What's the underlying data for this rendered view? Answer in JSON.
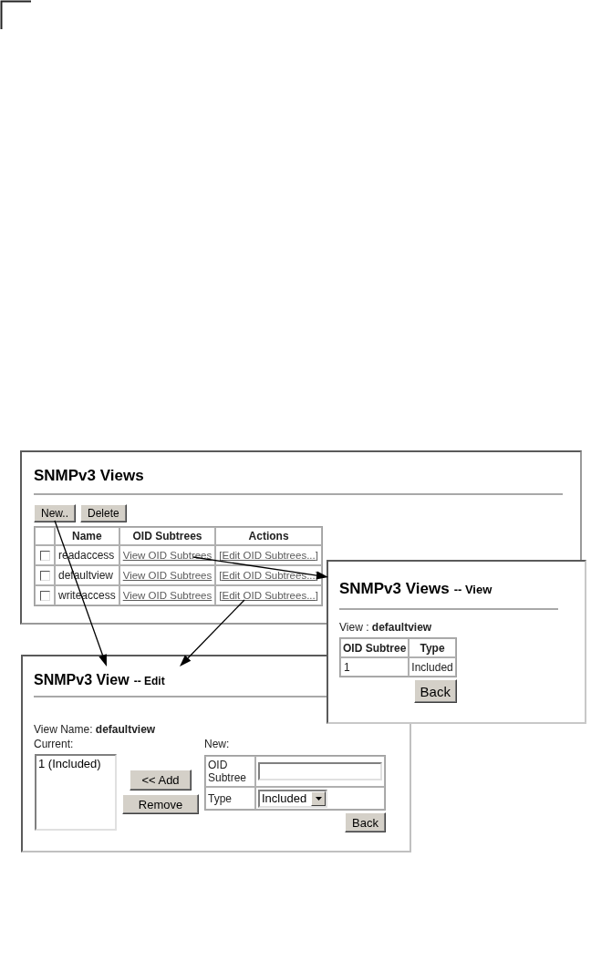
{
  "views_window": {
    "title": "SNMPv3 Views",
    "buttons": [
      {
        "label": "New.."
      },
      {
        "label": "Delete"
      }
    ],
    "table": {
      "columns": [
        "Name",
        "OID Subtrees",
        "Actions"
      ],
      "rows": [
        {
          "checked": false,
          "name": "readaccess",
          "view_link": "View OID Subtrees",
          "edit_link": "[Edit OID Subtrees...]"
        },
        {
          "checked": false,
          "name": "defaultview",
          "view_link": "View OID Subtrees",
          "edit_link": "[Edit OID Subtrees...]"
        },
        {
          "checked": false,
          "name": "writeaccess",
          "view_link": "View OID Subtrees",
          "edit_link": "[Edit OID Subtrees...]"
        }
      ]
    }
  },
  "view_window": {
    "title": "SNMPv3 Views",
    "subtitle": "-- View",
    "view_line": "View : **defaultview**",
    "table": {
      "columns": [
        "OID Subtree",
        "Type"
      ],
      "rows": [
        {
          "oid_subtree": "1",
          "type": "Included"
        }
      ]
    },
    "back_button": "Back"
  },
  "edit_window": {
    "title": "SNMPv3 View",
    "subtitle": "-- Edit",
    "view_name_line": "View Name: **defaultview**",
    "current_label": "Current:",
    "current_items": [
      {
        "text": "1 (Included)",
        "selected": false
      }
    ],
    "buttons": [
      {
        "label": "<< Add"
      },
      {
        "label": "Remove"
      }
    ],
    "new_label": "New:",
    "form": {
      "rows": [
        {
          "kind": "input",
          "label": "OID Subtree"
        },
        {
          "kind": "select",
          "label": "Type",
          "value": "Included"
        }
      ]
    },
    "back_button": "Back"
  }
}
